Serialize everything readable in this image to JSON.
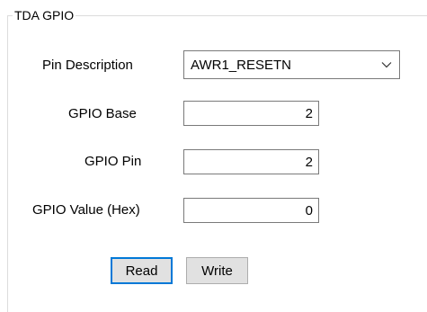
{
  "group": {
    "title": "TDA GPIO"
  },
  "pin_description": {
    "label": "Pin Description",
    "value": "AWR1_RESETN",
    "icon": "chevron-down-icon"
  },
  "gpio_base": {
    "label": "GPIO Base",
    "value": "2"
  },
  "gpio_pin": {
    "label": "GPIO Pin",
    "value": "2"
  },
  "gpio_value": {
    "label": "GPIO Value (Hex)",
    "value": "0"
  },
  "buttons": {
    "read": "Read",
    "write": "Write"
  }
}
